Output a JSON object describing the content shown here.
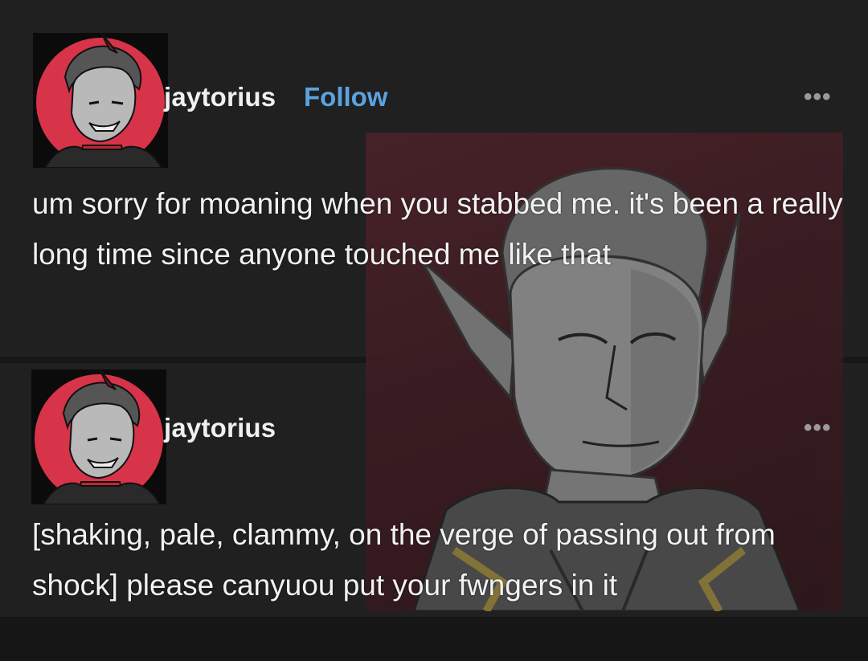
{
  "posts": [
    {
      "username": "jaytorius",
      "follow_label": "Follow",
      "more_icon": "more-options-icon",
      "more_label": "•••",
      "text": "um sorry for moaning when you stabbed me. it's been a really long time since anyone touched me like that"
    },
    {
      "username": "jaytorius",
      "more_icon": "more-options-icon",
      "more_label": "•••",
      "text": "[shaking, pale, clammy, on the verge of passing out from shock] please canyuou put your fwngers  in it"
    }
  ],
  "colors": {
    "background": "#202020",
    "text": "#f2f2f2",
    "follow": "#5ba3e0",
    "avatar_circle": "#d7344a",
    "artwork_bg": "#3b1c22"
  }
}
